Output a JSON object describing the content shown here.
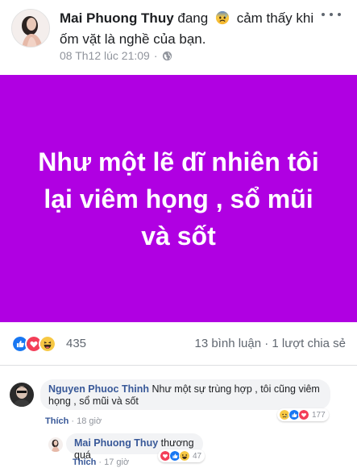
{
  "post": {
    "author": "Mai Phuong Thuy",
    "feeling_prefix": "đang",
    "feeling_text": "cảm thấy khi ốm vặt là nghề của bạn.",
    "timestamp": "08 Th12 lúc 21:09",
    "separator": "·",
    "status_text": "Như một lẽ dĩ nhiên tôi lại viêm họng , sổ mũi và sốt",
    "status_bg_color": "#b000e2"
  },
  "reactions": {
    "icons": [
      "like-icon",
      "love-icon",
      "haha-icon"
    ],
    "count": "435",
    "comments": "13 bình luận",
    "dot": "·",
    "shares": "1 lượt chia sẻ"
  },
  "comments": [
    {
      "author": "Nguyen Phuoc Thinh",
      "text": "Như một sự trùng hợp , tôi cũng viêm họng , sổ mũi và sốt",
      "like_label": "Thích",
      "dot": "·",
      "time": "18 giờ",
      "reaction_count": "177"
    },
    {
      "author": "Mai Phuong Thuy",
      "text": "thương quá",
      "like_label": "Thích",
      "dot": "·",
      "time": "17 giờ",
      "reaction_count": "47"
    }
  ]
}
